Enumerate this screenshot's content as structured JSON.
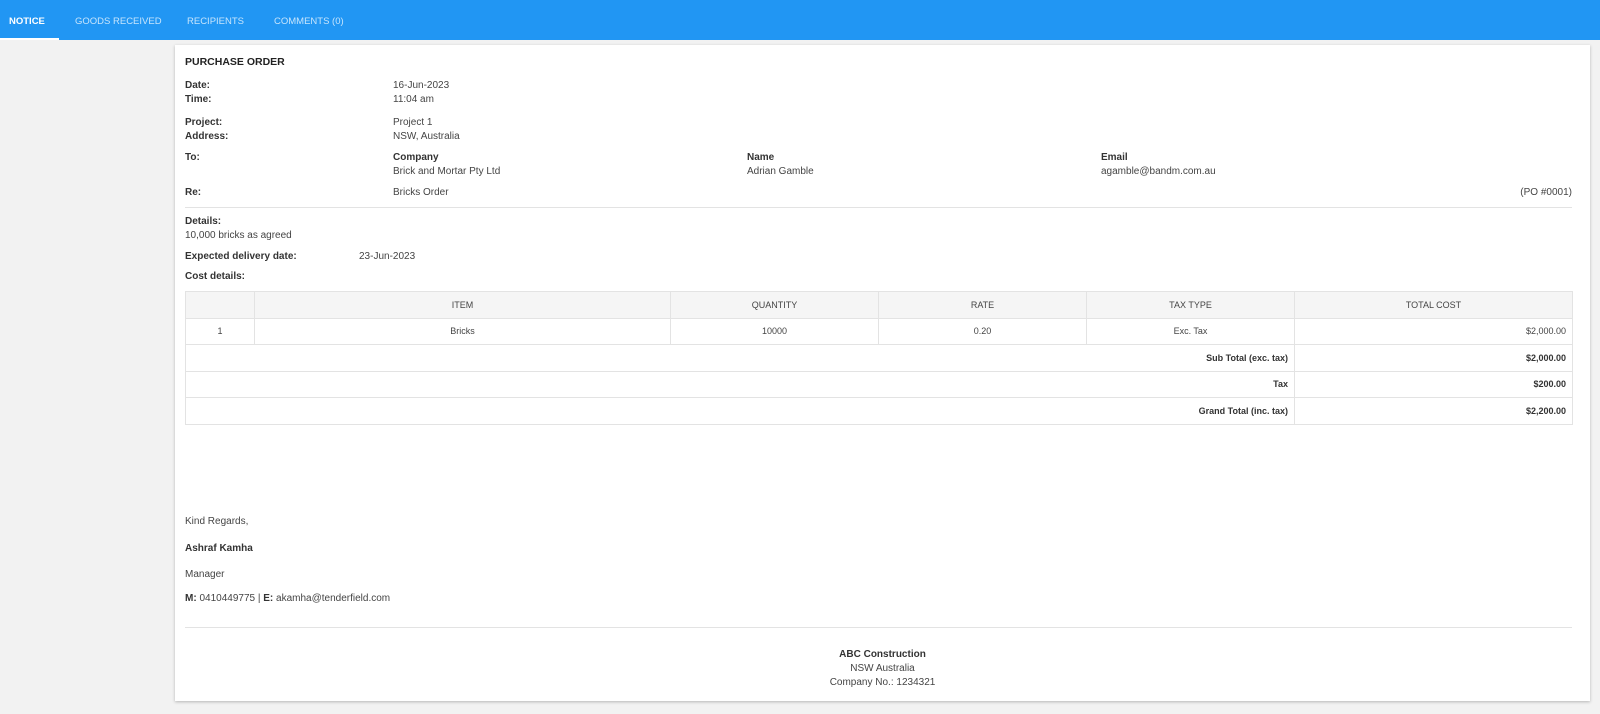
{
  "tabs": [
    {
      "label": "NOTICE"
    },
    {
      "label": "GOODS RECEIVED"
    },
    {
      "label": "RECIPIENTS"
    },
    {
      "label": "COMMENTS (0)"
    }
  ],
  "document": {
    "title": "PURCHASE ORDER",
    "date_label": "Date:",
    "date": "16-Jun-2023",
    "time_label": "Time:",
    "time": "11:04 am",
    "project_label": "Project:",
    "project": "Project 1",
    "address_label": "Address:",
    "address": "NSW, Australia",
    "to_label": "To:",
    "company_label": "Company",
    "company": "Brick and Mortar Pty Ltd",
    "name_label": "Name",
    "name": "Adrian Gamble",
    "email_label": "Email",
    "email": "agamble@bandm.com.au",
    "re_label": "Re:",
    "re": "Bricks Order",
    "po_number": "(PO #0001)",
    "details_label": "Details:",
    "details": "10,000 bricks as agreed",
    "delivery_label": "Expected delivery date:",
    "delivery_date": "23-Jun-2023",
    "cost_label": "Cost details:"
  },
  "table": {
    "headers": [
      "",
      "ITEM",
      "QUANTITY",
      "RATE",
      "TAX TYPE",
      "TOTAL COST"
    ],
    "rows": [
      {
        "num": "1",
        "item": "Bricks",
        "quantity": "10000",
        "rate": "0.20",
        "tax_type": "Exc. Tax",
        "total": "$2,000.00"
      }
    ],
    "subtotal_label": "Sub Total (exc. tax)",
    "subtotal": "$2,000.00",
    "tax_label": "Tax",
    "tax": "$200.00",
    "grand_total_label": "Grand Total (inc. tax)",
    "grand_total": "$2,200.00"
  },
  "signature": {
    "greeting": "Kind Regards,",
    "name": "Ashraf Kamha",
    "role": "Manager",
    "mobile_label": "M:",
    "mobile": "0410449775",
    "separator": "|",
    "email_label": "E:",
    "email": "akamha@tenderfield.com"
  },
  "footer": {
    "company": "ABC Construction",
    "location": "NSW Australia",
    "company_no": "Company No.: 1234321"
  },
  "colors": {
    "accent": "#2196f3"
  }
}
